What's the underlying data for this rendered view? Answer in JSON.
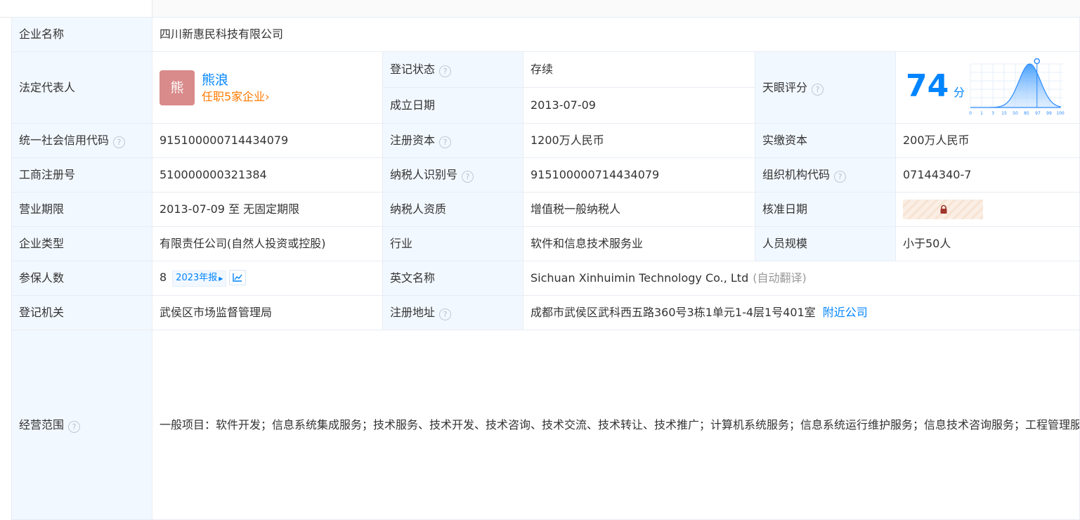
{
  "colors": {
    "accent": "#0084ff",
    "orange": "#ff7a00",
    "status_green": "#1fae5b",
    "label_bg": "#f2f8ff",
    "border": "#e8edf3"
  },
  "rows": {
    "company_name": {
      "label": "企业名称",
      "value": "四川新惠民科技有限公司"
    },
    "legal_rep": {
      "label": "法定代表人",
      "avatar_char": "熊",
      "name": "熊浪",
      "sub": "任职5家企业",
      "sub_icon": "chevron-right-icon"
    },
    "reg_status": {
      "label": "登记状态",
      "value": "存续"
    },
    "est_date": {
      "label": "成立日期",
      "value": "2013-07-09"
    },
    "tianyan_score": {
      "label": "天眼评分",
      "score": "74",
      "unit": "分",
      "distribution_axis": [
        "0",
        "1",
        "3",
        "15",
        "50",
        "85",
        "97",
        "99",
        "100"
      ],
      "level_fraction": 0.74
    },
    "credit_code": {
      "label": "统一社会信用代码",
      "value": "915100000714434079"
    },
    "reg_capital": {
      "label": "注册资本",
      "value": "1200万人民币"
    },
    "paid_capital": {
      "label": "实缴资本",
      "value": "200万人民币"
    },
    "biz_reg_no": {
      "label": "工商注册号",
      "value": "510000000321384"
    },
    "taxpayer_id": {
      "label": "纳税人识别号",
      "value": "915100000714434079"
    },
    "org_code": {
      "label": "组织机构代码",
      "value": "07144340-7"
    },
    "biz_term": {
      "label": "营业期限",
      "value": "2013-07-09 至 无固定期限"
    },
    "taxpayer_qual": {
      "label": "纳税人资质",
      "value": "增值税一般纳税人"
    },
    "approve_date": {
      "label": "核准日期",
      "locked_icon": "lock-icon"
    },
    "company_type": {
      "label": "企业类型",
      "value": "有限责任公司(自然人投资或控股)"
    },
    "industry": {
      "label": "行业",
      "value": "软件和信息技术服务业"
    },
    "staff_size": {
      "label": "人员规模",
      "value": "小于50人"
    },
    "insured": {
      "label": "参保人数",
      "value": "8",
      "badge": "2023年报",
      "badge_icon": "caret-right-icon",
      "trend_icon": "trend-chart-icon"
    },
    "english_name": {
      "label": "英文名称",
      "value": "Sichuan Xinhuimin Technology Co., Ltd",
      "note": "(自动翻译)"
    },
    "reg_authority": {
      "label": "登记机关",
      "value": "武侯区市场监督管理局"
    },
    "reg_address": {
      "label": "注册地址",
      "value": "成都市武侯区武科西五路360号3栋1单元1-4层1号401室",
      "link": "附近公司"
    },
    "biz_scope": {
      "label": "经营范围",
      "value": "一般项目：软件开发；信息系统集成服务；技术服务、技术开发、技术咨询、技术交流、技术转让、技术推广；计算机系统服务；信息系统运行维护服务；信息技术咨询服务；工程管理服务；市政设施管理；物联网技术服务；5G通信技术服务；物联网应用服务；物联网技术研发；工业互联网数据服务；数字技术服务；电子专用材料研发；城乡市容管理；环保咨询服务；能量回收系统研发；新材料技术研发；项目策划与公关服务；数据处理和存储支持服务；智能控制系统集成；工程和技术研究和试验发展；品牌管理；公共安全管理咨询服务；安全系统监控服务；人工智能应用软件开发；人工智能基础资源与技术平台；安全咨询服务；工业工程设计服务；专业设计服务；安防设备销售；电子产品销售；智能输配电及控制设备销售；集成电路芯片及产品销售；信息安全设备销售；物联网设备销售；电力电子元器件销售；电线、电缆经营；电气设备修理；电器辅件销售；电气设备销售；机械电气设备销售；园林绿化工程施工；规划设计管理；网络设备销售；工业控制计算机及系统销售；集成电路销售；电子元器件批发；绘图、计算及测量仪器销售；第一类医疗器械销售；电子测量仪器销售；第二类医疗器械销售；货物进出口。（除依法须经批准的项目外，凭营业执照依法自主开展经营活动）许可项目：建设工程施工；建筑智能化系统设计；电气安装服务；建设工程设计。（依法须经批准的项目，经相关部门批准后方可开展经营活动，具体经营项目以相关部门批准文件或许可证件为准)"
    }
  }
}
